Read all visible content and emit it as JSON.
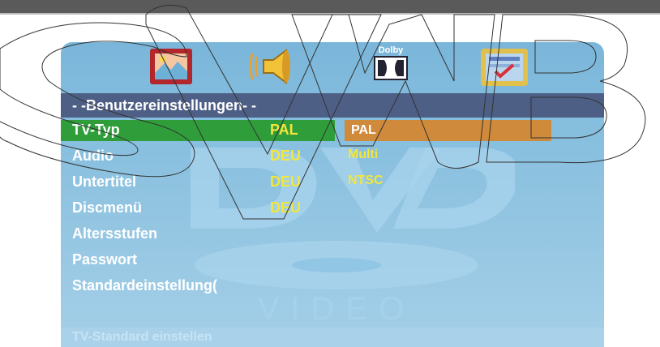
{
  "tabs": [
    {
      "name": "picture-tab",
      "icon": "picture-icon"
    },
    {
      "name": "audio-tab",
      "icon": "speaker-icon"
    },
    {
      "name": "dolby-tab",
      "icon": "dolby-icon",
      "label": "Dolby"
    },
    {
      "name": "preferences-tab",
      "icon": "checklist-icon"
    }
  ],
  "menu": {
    "title": "- -Benutzereinstellungen- -",
    "items": [
      {
        "label": "TV-Typ",
        "value": "PAL",
        "selected": true
      },
      {
        "label": "Audio",
        "value": "DEU"
      },
      {
        "label": "Untertitel",
        "value": "DEU"
      },
      {
        "label": "Discmenü",
        "value": "DEU"
      },
      {
        "label": "Altersstufen",
        "value": ""
      },
      {
        "label": "Passwort",
        "value": ""
      },
      {
        "label": "Standardeinstellung(",
        "value": ""
      }
    ]
  },
  "options": [
    "PAL",
    "Multi",
    "NTSC"
  ],
  "status": "TV-Standard einstellen",
  "background_logo": {
    "text": "VIDEO"
  },
  "colors": {
    "screen": "#89c0df",
    "header": "#4e5f86",
    "selected_item": "#2f9e3a",
    "selected_option": "#cf8a3c",
    "value_text": "#f2e63d"
  }
}
